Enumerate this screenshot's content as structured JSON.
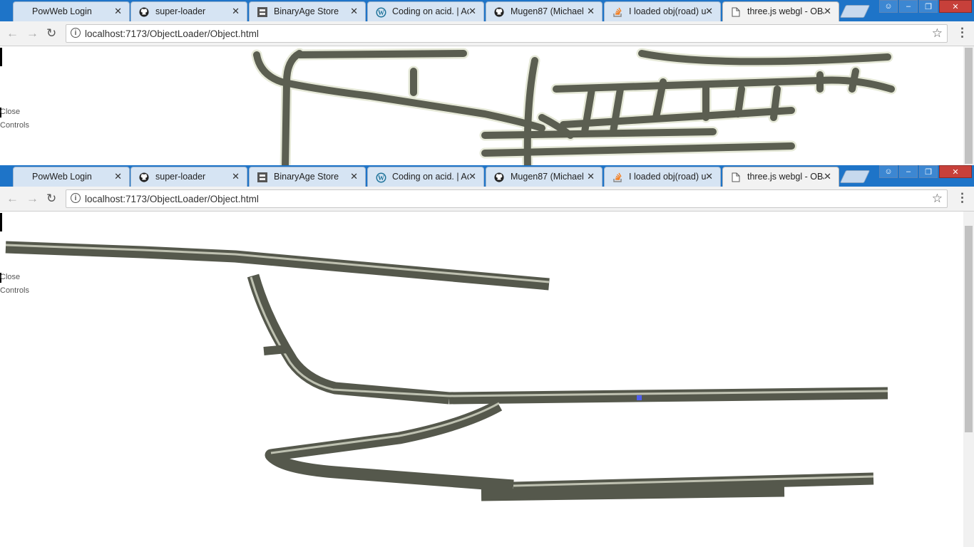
{
  "tabs": [
    {
      "title": "PowWeb Login",
      "icon": "none"
    },
    {
      "title": "super-loader",
      "icon": "github-icon"
    },
    {
      "title": "BinaryAge Store",
      "icon": "binaryage-icon"
    },
    {
      "title": "Coding on acid. | Ac",
      "icon": "wordpress-icon"
    },
    {
      "title": "Mugen87 (Michael",
      "icon": "github-icon"
    },
    {
      "title": "I loaded obj(road) u",
      "icon": "stackoverflow-icon"
    },
    {
      "title": "three.js webgl - OBJ",
      "icon": "page-icon",
      "active": true
    }
  ],
  "close_glyph": "✕",
  "address": {
    "url": "localhost:7173/ObjectLoader/Object.html",
    "info": "i"
  },
  "gui": {
    "close_label": "Close",
    "controls_label": "Controls"
  },
  "colors": {
    "tabstrip": "#1e74c8",
    "road": "#5a5d50",
    "highlight": "#e8ebdc"
  }
}
